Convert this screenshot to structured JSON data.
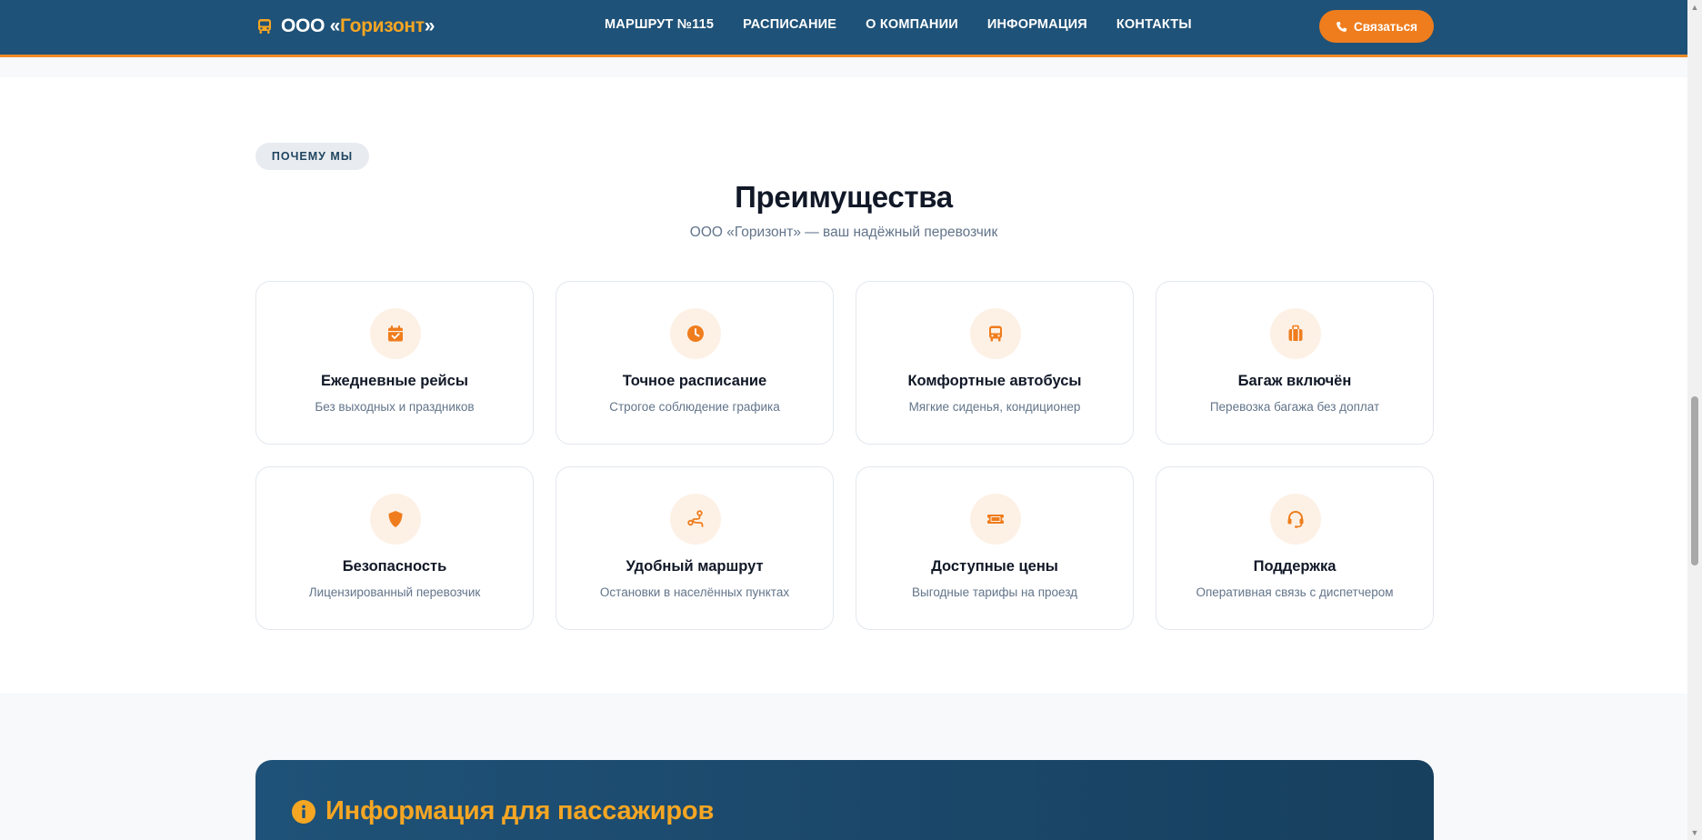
{
  "header": {
    "logo_prefix": "ООО «",
    "logo_name": "Горизонт",
    "logo_suffix": "»",
    "nav": [
      {
        "label": "МАРШРУТ №115"
      },
      {
        "label": "РАСПИСАНИЕ"
      },
      {
        "label": "О КОМПАНИИ"
      },
      {
        "label": "ИНФОРМАЦИЯ"
      },
      {
        "label": "КОНТАКТЫ"
      }
    ],
    "cta_label": "Связаться"
  },
  "advantages": {
    "badge": "ПОЧЕМУ МЫ",
    "title": "Преимущества",
    "subtitle": "ООО «Горизонт» — ваш надёжный перевозчик",
    "cards": [
      {
        "icon": "calendar-check-icon",
        "title": "Ежедневные рейсы",
        "desc": "Без выходных и праздников"
      },
      {
        "icon": "clock-icon",
        "title": "Точное расписание",
        "desc": "Строгое соблюдение графика"
      },
      {
        "icon": "bus-icon",
        "title": "Комфортные автобусы",
        "desc": "Мягкие сиденья, кондиционер"
      },
      {
        "icon": "suitcase-icon",
        "title": "Багаж включён",
        "desc": "Перевозка багажа без доплат"
      },
      {
        "icon": "shield-icon",
        "title": "Безопасность",
        "desc": "Лицензированный перевозчик"
      },
      {
        "icon": "route-icon",
        "title": "Удобный маршрут",
        "desc": "Остановки в населённых пунктах"
      },
      {
        "icon": "ticket-icon",
        "title": "Доступные цены",
        "desc": "Выгодные тарифы на проезд"
      },
      {
        "icon": "headset-icon",
        "title": "Поддержка",
        "desc": "Оперативная связь с диспетчером"
      }
    ]
  },
  "info": {
    "title": "Информация для пассажиров",
    "icon": "info-circle-icon"
  },
  "colors": {
    "header_bg": "#1f5278",
    "accent": "#ef7d1d",
    "logo_accent": "#f5a623",
    "icon_bg": "#fdf1e6"
  }
}
